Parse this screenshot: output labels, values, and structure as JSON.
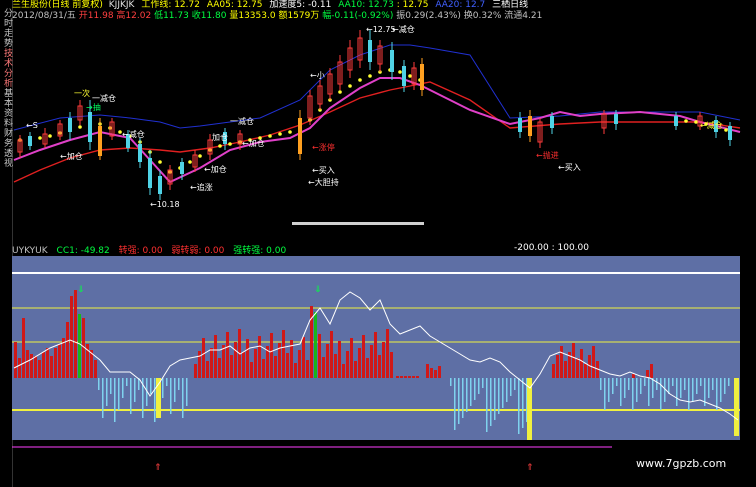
{
  "sidebar": {
    "tabs": [
      {
        "label": "分时走势",
        "active": false
      },
      {
        "label": "技术分析",
        "active": true
      },
      {
        "label": "基本资料",
        "active": false
      },
      {
        "label": "财务透视",
        "active": false
      }
    ]
  },
  "header": {
    "stock_title": "兰生股份(日线 前复权)",
    "indicator_name": "KJJKJK",
    "line1_label": "工作线: 12.72",
    "aa05_label": "AA05: 12.75",
    "accel_label": "加速度5: -0.11",
    "aa10_label": "AA10: 12.73",
    "value_label": ": 12.75",
    "aa20_label": "AA20: 12.7",
    "right_label": "三栖日线",
    "date": "2012/08/31/五",
    "open": "开11.98",
    "high": "高12.02",
    "low": "低11.73",
    "close": "收11.80",
    "volume": "量13353.0",
    "amount": "额1579万",
    "change": "幅-0.11(-0.92%)",
    "amplitude": "振0.29(2.43%)",
    "turnover": "换0.32%",
    "float": "流通4.21"
  },
  "chart_annotations": {
    "labels": [
      "一次",
      "→抽",
      "一减仓",
      "←S",
      "←加仓",
      "←减仓",
      "←追涨",
      "←加仓",
      "加仓",
      "←10.18",
      "一减仓",
      "←减仓",
      "←12.75",
      "←小",
      "←买入",
      "←大胆持",
      "←减仓",
      "←买入",
      "←抛进",
      "卖出",
      "←S",
      "←减仓",
      "←买"
    ]
  },
  "indicator": {
    "name": "UYKYUK",
    "cc1": "CC1: -49.82",
    "weak_to_strong": "转强: 0.00",
    "strong_to_weak": "弱转弱: 0.00",
    "strong_to_strong": "强转强: 0.00",
    "range_label": "-200.00 : 100.00"
  },
  "watermark": {
    "text": "www.7gpzb.com"
  },
  "colors": {
    "background": "#000000",
    "panel": "#5e6fa5",
    "up_candle": "#ff3b3b",
    "down_candle": "#4fd3e6",
    "ma_magenta": "#e040c8",
    "ma_blue": "#3050ff",
    "dots": "#ffff33",
    "red_bar": "#d01818",
    "cyan_bar": "#7fd3ee",
    "green_bar": "#18b818",
    "yellow_line": "#f0f040",
    "white_line": "#ffffff"
  }
}
